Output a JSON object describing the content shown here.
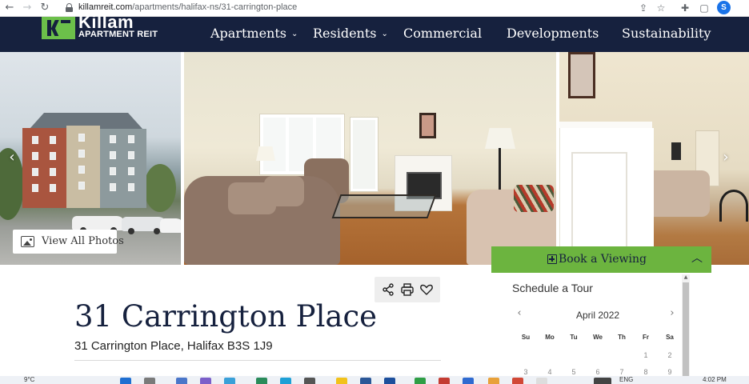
{
  "browser": {
    "url_domain": "killamreit.com",
    "url_path": "/apartments/halifax-ns/31-carrington-place",
    "profile_initial": "S"
  },
  "site": {
    "logo_word": "Killam",
    "logo_sub": "APARTMENT REIT",
    "nav": [
      "Apartments",
      "Residents",
      "Commercial",
      "Developments",
      "Sustainability"
    ]
  },
  "gallery": {
    "view_all_label": "View All Photos"
  },
  "property": {
    "title": "31 Carrington Place",
    "address": "31 Carrington Place, Halifax B3S 1J9"
  },
  "booking": {
    "header_label": "Book a Viewing",
    "schedule_title": "Schedule a Tour",
    "month": "April 2022",
    "weekdays": [
      "Su",
      "Mo",
      "Tu",
      "We",
      "Th",
      "Fr",
      "Sa"
    ],
    "week1": [
      "",
      "",
      "",
      "",
      "",
      "1",
      "2"
    ],
    "week2": [
      "3",
      "4",
      "5",
      "6",
      "7",
      "8",
      "9"
    ]
  },
  "taskbar": {
    "weather": "9°C",
    "language": "ENG",
    "time": "4:02 PM"
  },
  "colors": {
    "brand_navy": "#16213e",
    "brand_green": "#6cb43f"
  }
}
